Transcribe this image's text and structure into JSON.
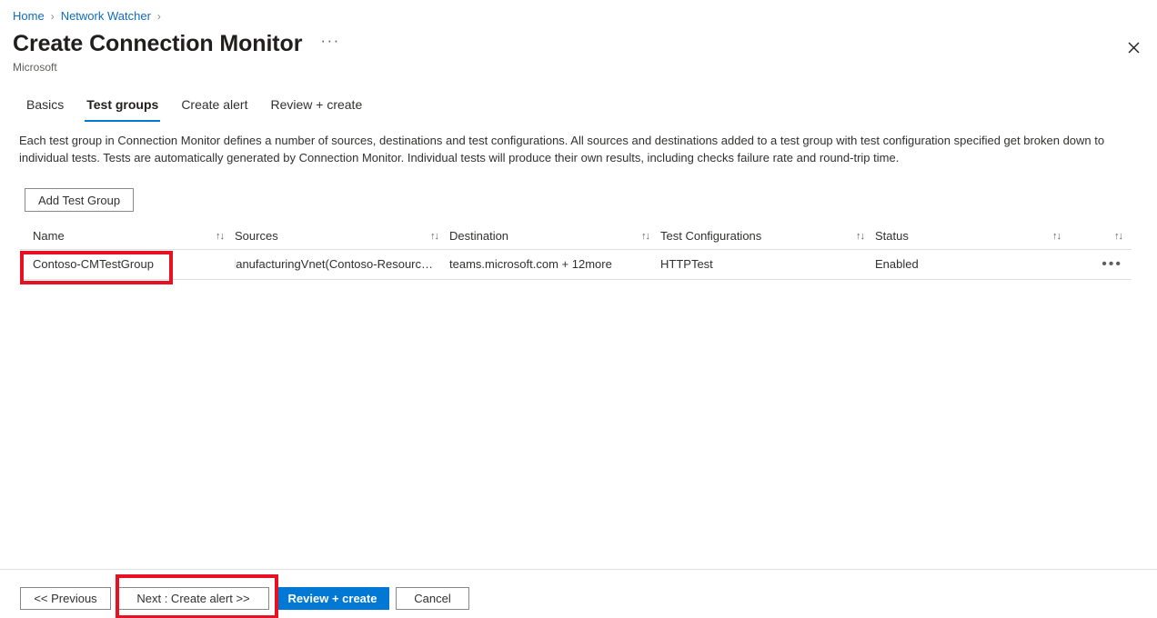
{
  "breadcrumb": {
    "items": [
      {
        "label": "Home",
        "link": true
      },
      {
        "label": "Network Watcher",
        "link": true
      }
    ],
    "separator": "›"
  },
  "header": {
    "title": "Create Connection Monitor",
    "more_icon": "···",
    "subtitle": "Microsoft",
    "close_icon": "✕"
  },
  "tabs": [
    {
      "label": "Basics",
      "active": false
    },
    {
      "label": "Test groups",
      "active": true
    },
    {
      "label": "Create alert",
      "active": false
    },
    {
      "label": "Review + create",
      "active": false
    }
  ],
  "description": "Each test group in Connection Monitor defines a number of sources, destinations and test configurations. All sources and destinations added to a test group with test configuration specified get broken down to individual tests. Tests are automatically generated by Connection Monitor. Individual tests will produce their own results, including checks failure rate and round-trip time.",
  "toolbar": {
    "add_test_group_label": "Add Test Group"
  },
  "table": {
    "sort_icon": "↑↓",
    "row_menu_icon": "•••",
    "columns": [
      {
        "label": "Name",
        "sortable": true
      },
      {
        "label": "Sources",
        "sortable": true
      },
      {
        "label": "Destination",
        "sortable": true
      },
      {
        "label": "Test Configurations",
        "sortable": true
      },
      {
        "label": "Status",
        "sortable": true
      },
      {
        "label": "",
        "sortable": true
      }
    ],
    "rows": [
      {
        "name": "Contoso-CMTestGroup",
        "sources": "ManufacturingVnet(Contoso-Resourc…",
        "destination": "teams.microsoft.com + 12more",
        "test_configurations": "HTTPTest",
        "status": "Enabled"
      }
    ]
  },
  "footer": {
    "previous_label": "<< Previous",
    "next_label": "Next : Create alert >>",
    "review_create_label": "Review + create",
    "cancel_label": "Cancel"
  },
  "colors": {
    "accent": "#0078d4",
    "link": "#0f6cbd",
    "highlight": "#e81123",
    "text": "#323130",
    "border": "#e1dfdd"
  }
}
